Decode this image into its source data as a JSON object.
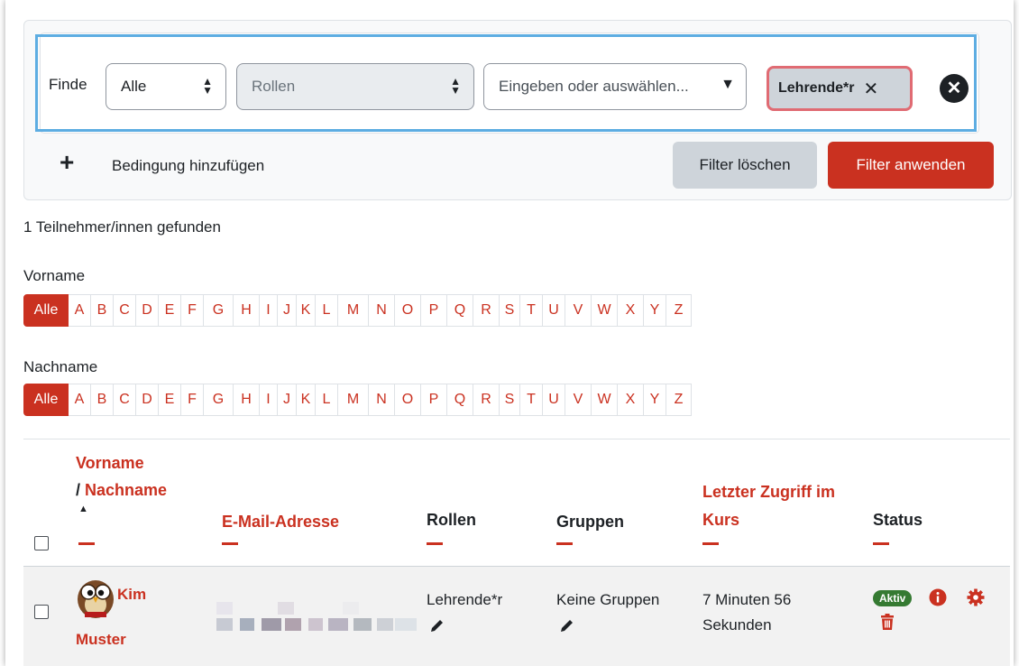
{
  "filter": {
    "finde_label": "Finde",
    "match_value": "Alle",
    "type_value": "Rollen",
    "search_placeholder": "Eingeben oder auswählen...",
    "chip_label": "Lehrende*r",
    "chip_remove": "✕",
    "remove_row": "✕",
    "add_condition_label": "Bedingung hinzufügen",
    "clear_label": "Filter löschen",
    "apply_label": "Filter anwenden"
  },
  "result_count": "1 Teilnehmer/innen gefunden",
  "firstname_label": "Vorname",
  "lastname_label": "Nachname",
  "alphabet": [
    "Alle",
    "A",
    "B",
    "C",
    "D",
    "E",
    "F",
    "G",
    "H",
    "I",
    "J",
    "K",
    "L",
    "M",
    "N",
    "O",
    "P",
    "Q",
    "R",
    "S",
    "T",
    "U",
    "V",
    "W",
    "X",
    "Y",
    "Z"
  ],
  "table": {
    "col_firstname": "Vorname",
    "col_slash": "/",
    "col_lastname": "Nachname",
    "col_email": "E-Mail-Adresse",
    "col_roles": "Rollen",
    "col_groups": "Gruppen",
    "col_lastaccess_1": "Letzter Zugriff im",
    "col_lastaccess_2": "Kurs",
    "col_status": "Status",
    "sort_glyph": "▲",
    "row": {
      "firstname": "Kim",
      "lastname": "Muster",
      "role": "Lehrende*r",
      "groups": "Keine Gruppen",
      "lastaccess_1": "7 Minuten 56",
      "lastaccess_2": "Sekunden",
      "status": "Aktiv"
    }
  },
  "colors": {
    "accent": "#ca3120",
    "success": "#357a32",
    "highlight": "#5dade2"
  }
}
